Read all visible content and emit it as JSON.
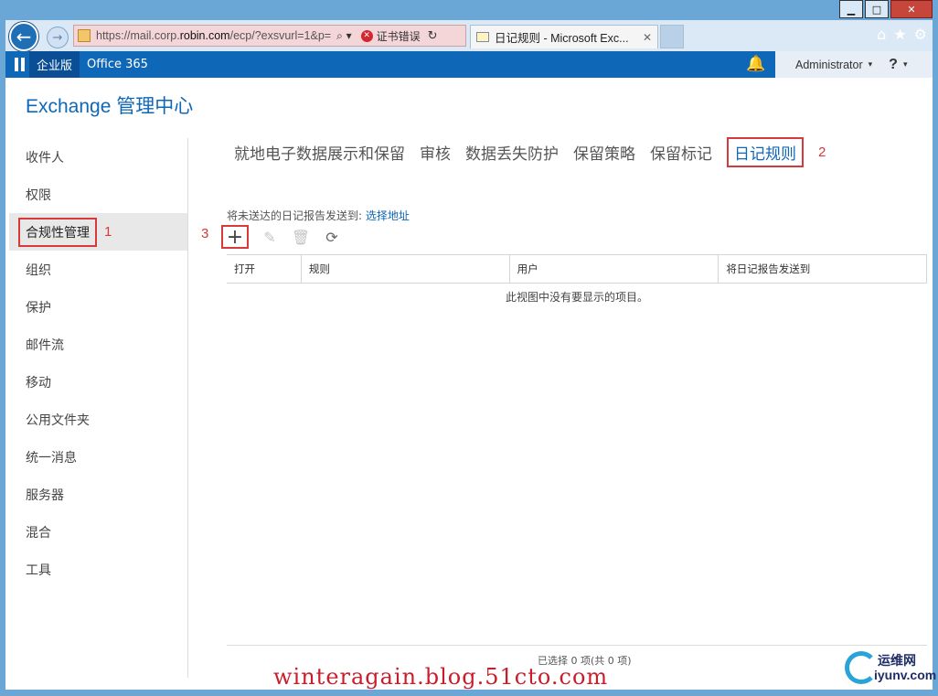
{
  "window": {
    "minimize": "▁",
    "maximize": "□",
    "close": "✕"
  },
  "browser": {
    "back_icon": "←",
    "forward_icon": "→",
    "url_prefix": "https://mail.corp.",
    "url_domain": "robin.com",
    "url_suffix": "/ecp/?exsvurl=1&p=",
    "search_icon": "⌕ ▾",
    "cert_error": "证书错误",
    "refresh_icon": "↻",
    "tab_title": "日记规则 - Microsoft Exc...",
    "tab_close": "✕",
    "home_icon": "⌂",
    "favorites_icon": "★",
    "tools_icon": "⚙"
  },
  "suite": {
    "edition": "企业版",
    "office365": "Office 365",
    "bell_icon": "🔔",
    "user": "Administrator",
    "caret": "▾",
    "help": "?",
    "help_caret": "▾"
  },
  "app_title": "Exchange 管理中心",
  "nav": {
    "items": [
      {
        "label": "收件人"
      },
      {
        "label": "权限"
      },
      {
        "label": "合规性管理"
      },
      {
        "label": "组织"
      },
      {
        "label": "保护"
      },
      {
        "label": "邮件流"
      },
      {
        "label": "移动"
      },
      {
        "label": "公用文件夹"
      },
      {
        "label": "统一消息"
      },
      {
        "label": "服务器"
      },
      {
        "label": "混合"
      },
      {
        "label": "工具"
      }
    ],
    "selected_annotation": "1"
  },
  "tabs": {
    "items": [
      {
        "label": "就地电子数据展示和保留"
      },
      {
        "label": "审核"
      },
      {
        "label": "数据丢失防护"
      },
      {
        "label": "保留策略"
      },
      {
        "label": "保留标记"
      },
      {
        "label": "日记规则"
      }
    ],
    "active_annotation": "2"
  },
  "sendto": {
    "text": "将未送达的日记报告发送到:",
    "link": "选择地址"
  },
  "toolbar": {
    "annotation": "3",
    "add_icon": "+",
    "edit_icon": "✎",
    "delete_icon": "🗑",
    "refresh_icon": "⟳"
  },
  "grid": {
    "columns": [
      "打开",
      "规则",
      "用户",
      "将日记报告发送到"
    ],
    "empty_message": "此视图中没有要显示的项目。"
  },
  "status": "已选择 0 项(共 0 项)",
  "watermark": "winteragain.blog.51cto.com",
  "logo": {
    "line1": "运维网",
    "line2": "iyunv.com"
  },
  "colors": {
    "suite_bar": "#0f67b8",
    "annotation_red": "#d63a3a",
    "link_blue": "#0f67b8"
  }
}
